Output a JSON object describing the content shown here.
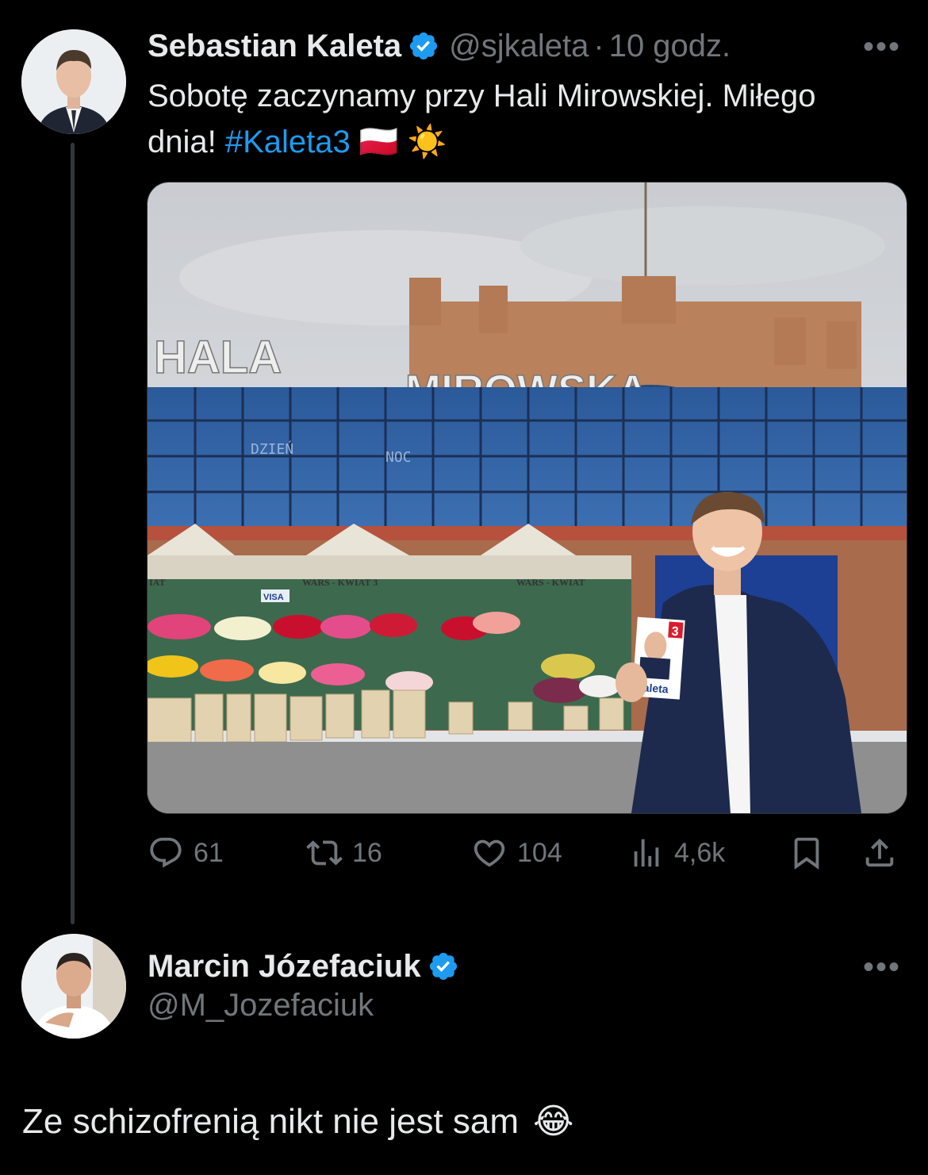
{
  "tweet": {
    "author_name": "Sebastian Kaleta",
    "handle": "@sjkaleta",
    "separator": "·",
    "time": "10 godz.",
    "text_line1": "Sobotę zaczynamy przy Hali Mirowskiej. Miłego",
    "text_line2_prefix": "dnia! ",
    "hashtag": "#Kaleta3",
    "emoji_flag": "🇵🇱",
    "emoji_sun": "☀️",
    "more": "•••",
    "image": {
      "sign_hala": "HALA",
      "sign_mirowska": "MIROWSKA",
      "led_left": "DZIEŃ",
      "led_right": "NOC",
      "stall_left_sign": "WARS - KWIAT 3",
      "stall_right_sign": "WARS - KWIAT",
      "stall_edge_sign": "IAT",
      "visa": "VISA",
      "leaflet_number": "3",
      "leaflet_name": "Kaleta"
    },
    "stats": {
      "replies": "61",
      "reposts": "16",
      "likes": "104",
      "views": "4,6k"
    }
  },
  "reply": {
    "author_name": "Marcin Józefaciuk",
    "handle": "@M_Jozefaciuk",
    "more": "•••",
    "text": "Ze schizofrenią nikt nie jest sam",
    "emoji": "😂"
  },
  "colors": {
    "background": "#000000",
    "text": "#e7e9ea",
    "muted": "#71767b",
    "accent": "#1d9bf0"
  }
}
